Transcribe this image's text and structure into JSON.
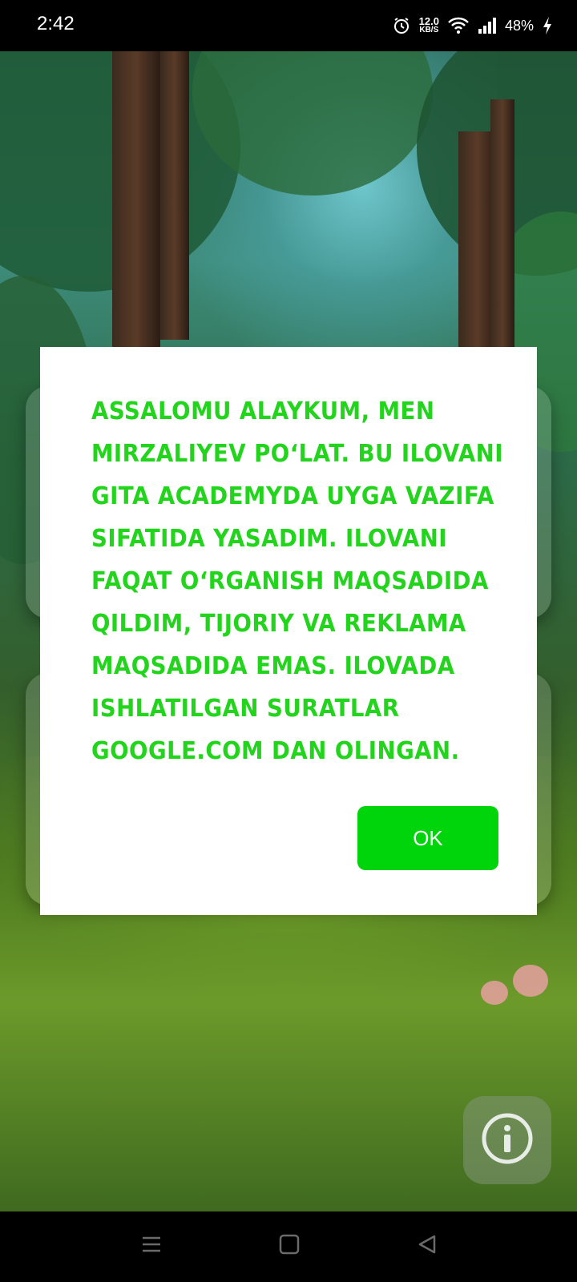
{
  "status_bar": {
    "time": "2:42",
    "net_speed_value": "12.0",
    "net_speed_unit": "KB/S",
    "battery_percent": "48%",
    "icons": [
      "alarm-icon",
      "wifi-icon",
      "signal-icon",
      "battery-charging-icon"
    ]
  },
  "dialog": {
    "message": "Assalomu alaykum, men Mirzaliyev Po‘lat. Bu ilovani Gita Academyda uyga vazifa sifatida yasadim. Ilovani faqat o‘rganish maqsadida qildim, tijoriy va reklama maqsadida emas. Ilovada ishlatilgan suratlar google.com dan olingan.",
    "ok_label": "OK",
    "text_color": "#22d41c",
    "button_color": "#00d40a"
  },
  "fab": {
    "icon": "info-icon"
  },
  "nav_bar": {
    "icons": [
      "menu-icon",
      "home-icon",
      "back-icon"
    ]
  }
}
